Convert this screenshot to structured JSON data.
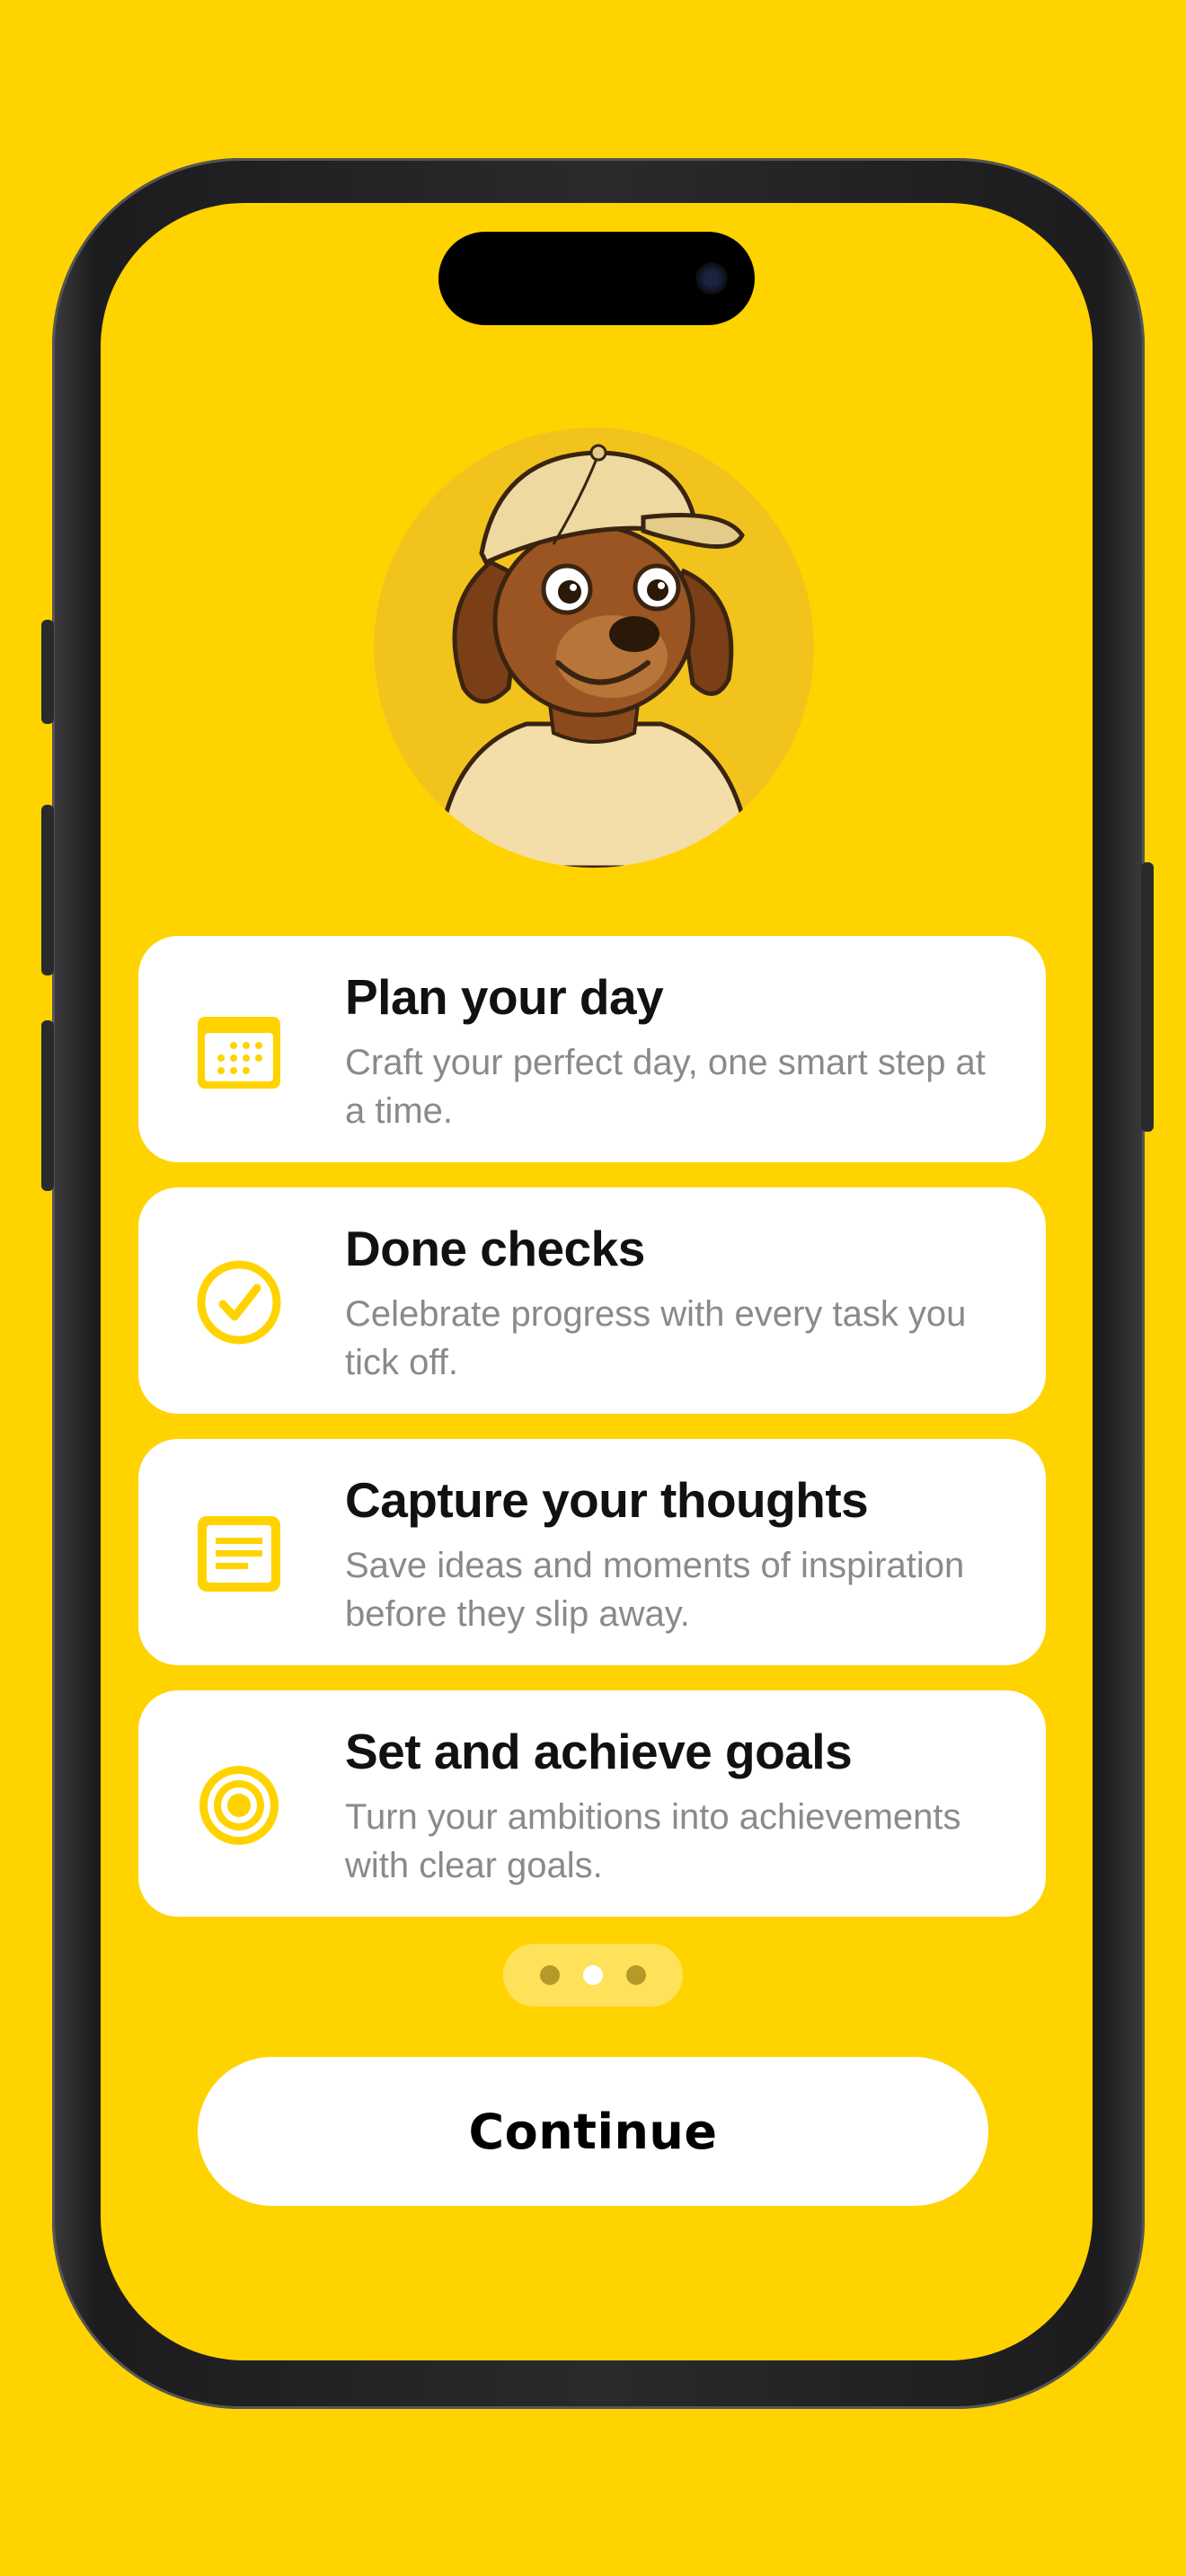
{
  "features": [
    {
      "title": "Plan your day",
      "desc": "Craft your perfect day, one smart step at a time.",
      "icon": "calendar-icon"
    },
    {
      "title": "Done checks",
      "desc": "Celebrate progress with every task you tick off.",
      "icon": "check-circle-icon"
    },
    {
      "title": "Capture your thoughts",
      "desc": "Save ideas and moments of inspiration before they slip away.",
      "icon": "note-icon"
    },
    {
      "title": "Set and achieve goals",
      "desc": "Turn your ambitions into achievements with clear goals.",
      "icon": "target-icon"
    }
  ],
  "pager": {
    "total": 3,
    "active_index": 1
  },
  "continue_label": "Continue",
  "colors": {
    "background": "#FFD300",
    "accent": "#FFD300",
    "card": "#FFFFFF",
    "title": "#111111",
    "description": "#8A8A8A"
  }
}
